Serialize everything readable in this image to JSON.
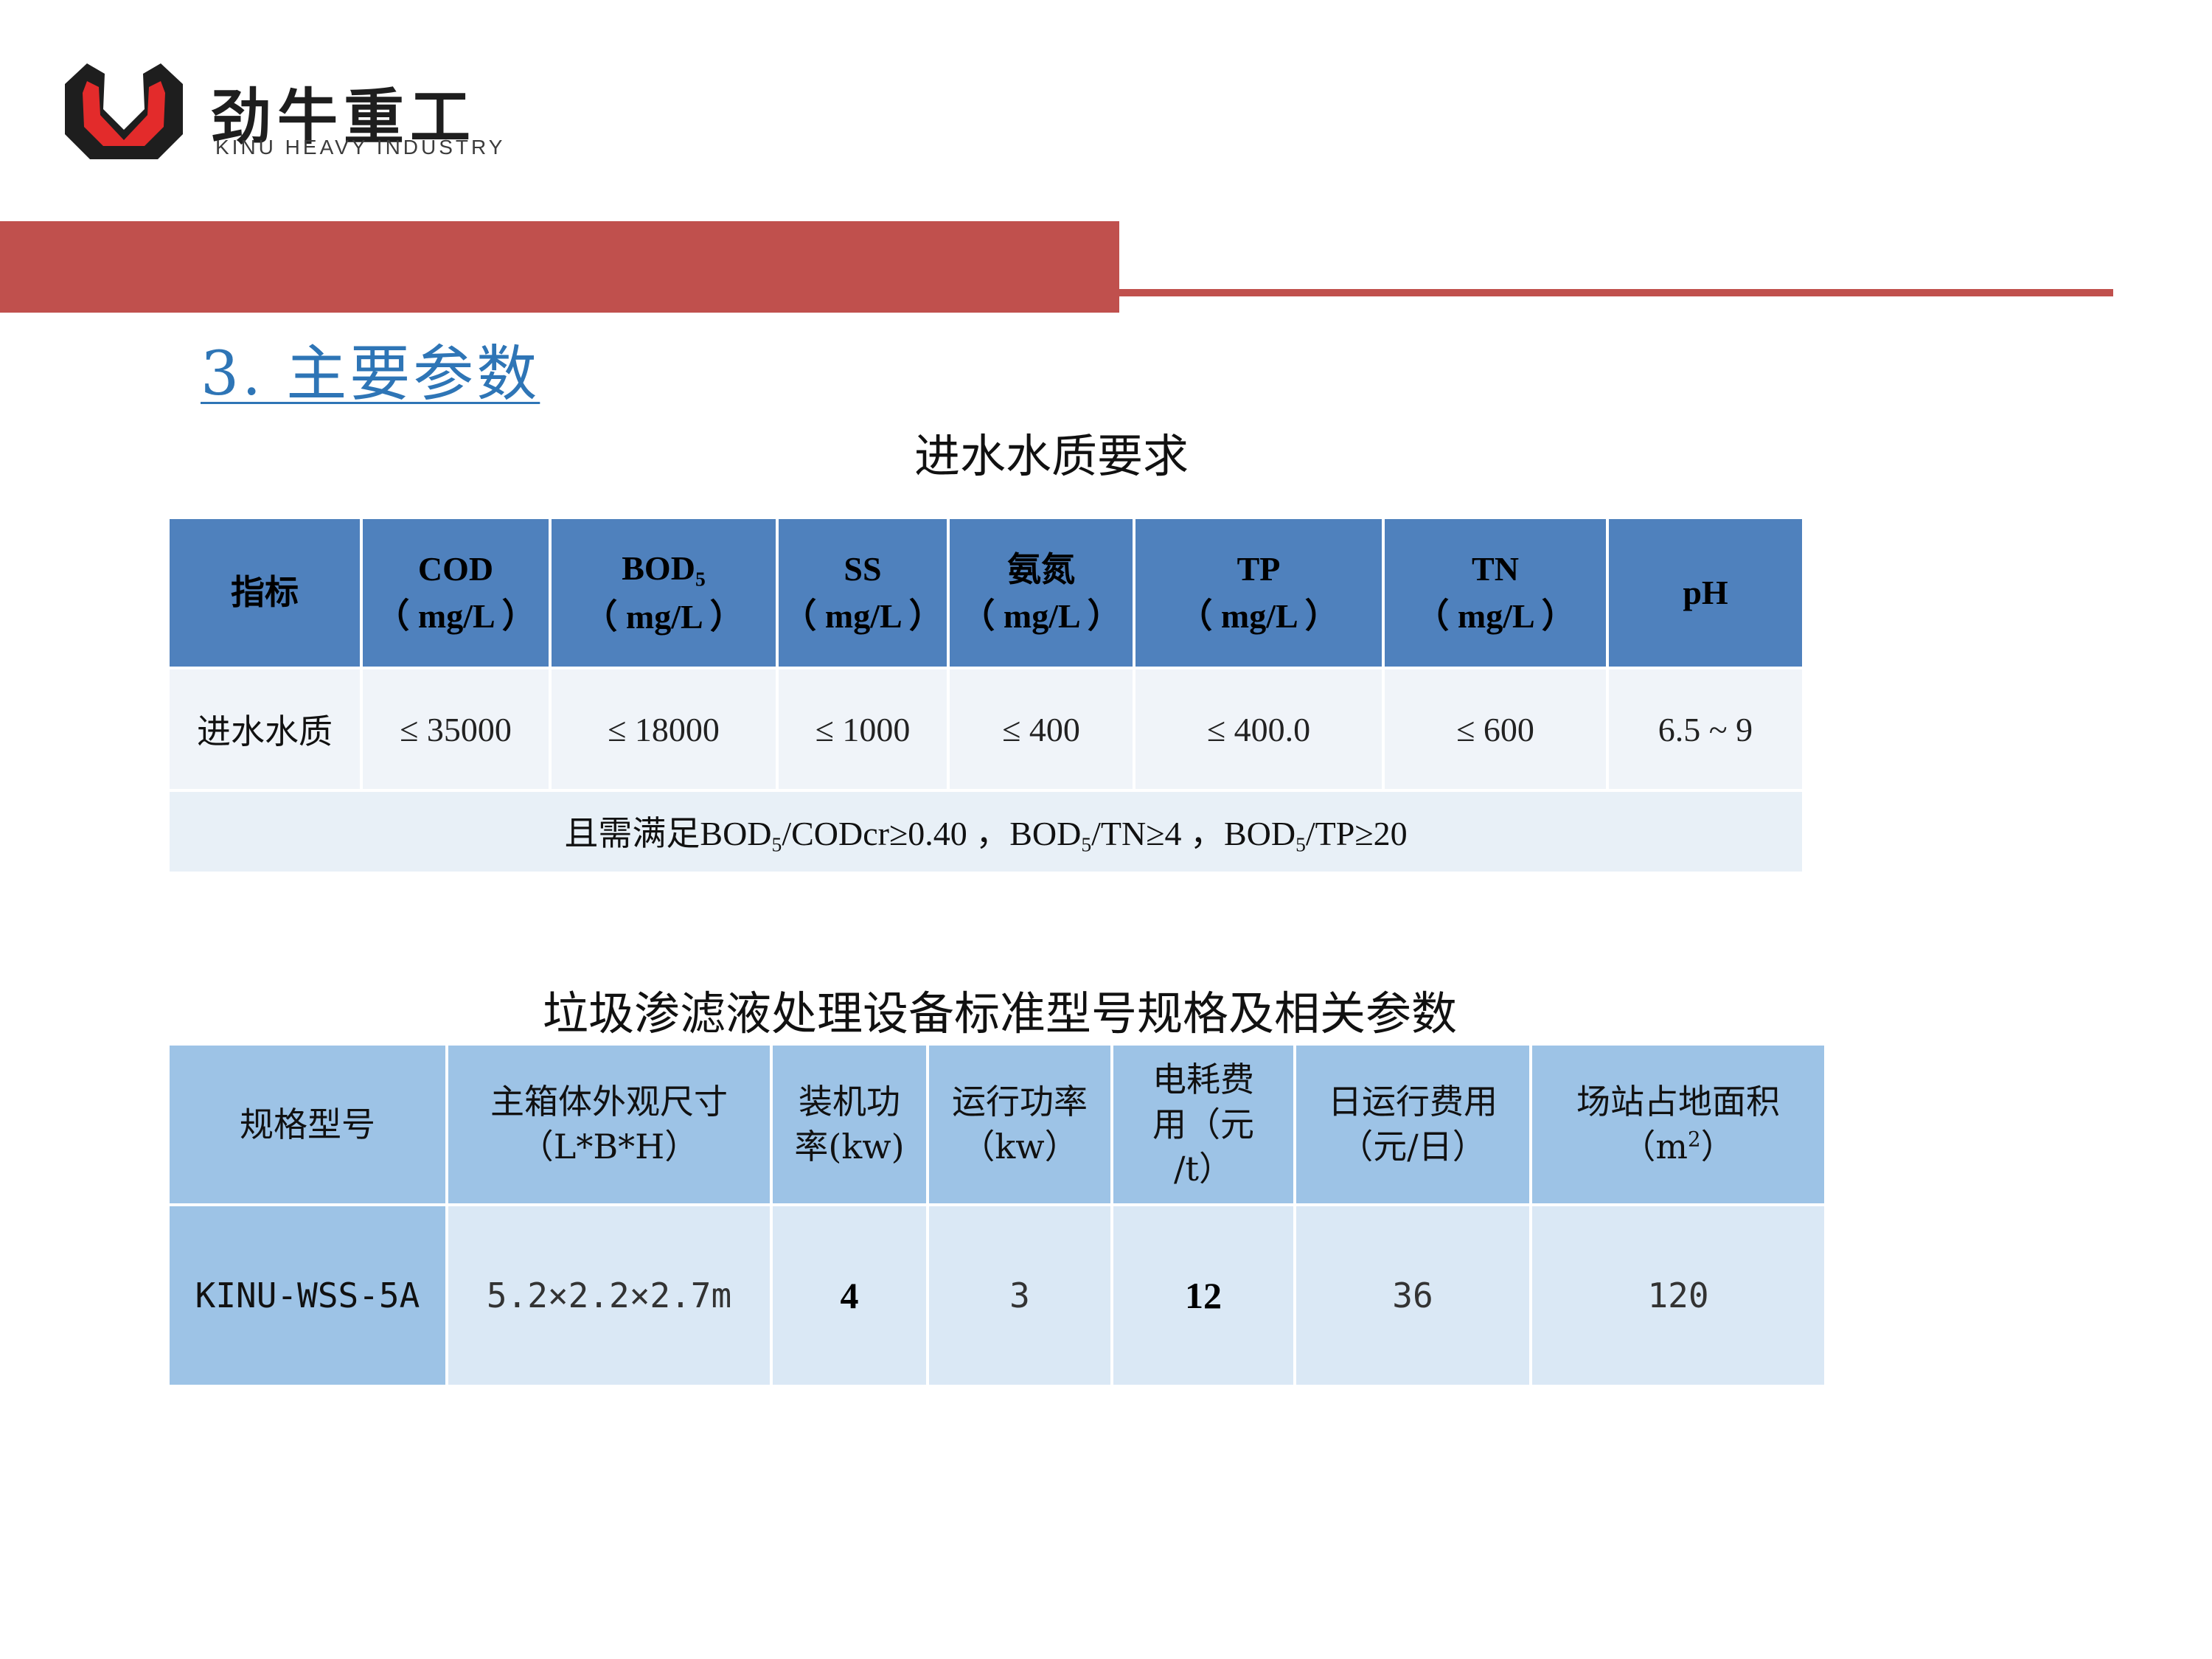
{
  "brand": {
    "name_cn": "劲牛重工",
    "name_en": "KINU HEAVY INDUSTRY",
    "colors": {
      "red": "#c0504d",
      "logo_black": "#1e1e1e",
      "logo_red": "#e32b2b"
    }
  },
  "section_title": "3.  主要参数",
  "table1": {
    "title": "进水水质要求",
    "headers": [
      {
        "main": "指标"
      },
      {
        "main": "COD",
        "unit": "（ mg/L ）"
      },
      {
        "main": "BOD",
        "sub": "5",
        "unit": "（ mg/L ）"
      },
      {
        "main": "SS",
        "unit": "（ mg/L ）"
      },
      {
        "main": "氨氮",
        "unit": "（ mg/L ）"
      },
      {
        "main": "TP",
        "unit": "（ mg/L ）"
      },
      {
        "main": "TN",
        "unit": "（ mg/L ）"
      },
      {
        "main": "pH"
      }
    ],
    "row": [
      "进水水质",
      "≤ 35000",
      "≤ 18000",
      "≤ 1000",
      "≤ 400",
      "≤ 400.0",
      "≤ 600",
      "6.5 ~ 9"
    ],
    "note": {
      "p1": "且需满足BOD",
      "s1": "5",
      "p2": "/CODcr≥0.40 ，BOD",
      "s2": "5",
      "p3": "/TN≥4 ，BOD",
      "s3": "5",
      "p4": "/TP≥20"
    },
    "colors": {
      "header_bg": "#4f81bd",
      "body_bg": "#f0f4f9"
    }
  },
  "table2": {
    "title": "垃圾渗滤液处理设备标准型号规格及相关参数",
    "headers": [
      {
        "l1": "规格型号"
      },
      {
        "l1": "主箱体外观尺寸",
        "l2": "（L*B*H）"
      },
      {
        "l1": "装机功",
        "l2": "率(kw)"
      },
      {
        "l1": "运行功率",
        "l2": "（kw）"
      },
      {
        "l1": "电耗费",
        "l2": "用（元",
        "l3": "/t）"
      },
      {
        "l1": "日运行费用",
        "l2": "（元/日）"
      },
      {
        "l1": "场站占地面积",
        "l2a": "（m",
        "l2sup": "2",
        "l2b": "）"
      }
    ],
    "row": [
      "KINU-WSS-5A",
      "5.2×2.2×2.7m",
      "4",
      "3",
      "12",
      "36",
      "120"
    ],
    "colors": {
      "header_bg": "#9dc3e6",
      "body_bg": "#dae8f5"
    }
  }
}
